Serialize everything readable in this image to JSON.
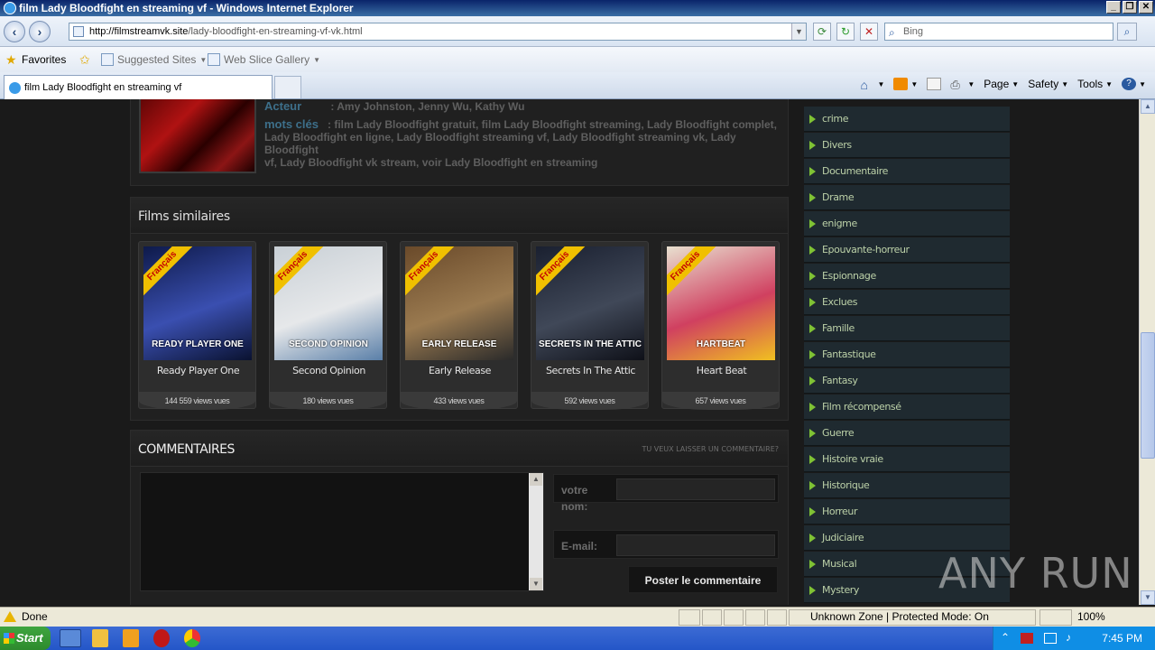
{
  "window": {
    "title": "film Lady Bloodfight en streaming vf - Windows Internet Explorer"
  },
  "address": {
    "url_host": "http://filmstreamvk.site",
    "url_path": "/lady-bloodfight-en-streaming-vf-vk.html",
    "search_placeholder": "Bing"
  },
  "favorites": {
    "favorites_label": "Favorites",
    "suggested_label": "Suggested Sites",
    "webslice_label": "Web Slice Gallery"
  },
  "tab": {
    "title": "film Lady Bloodfight en streaming vf"
  },
  "commands": {
    "page": "Page",
    "safety": "Safety",
    "tools": "Tools"
  },
  "info": {
    "actor_label": "Acteur",
    "actor_value": ": Amy Johnston, Jenny Wu, Kathy Wu",
    "keywords_label": "mots clés",
    "keywords_line1": ": film Lady Bloodfight gratuit, film Lady Bloodfight streaming, Lady Bloodfight complet,",
    "keywords_line2": "Lady Bloodfight en ligne, Lady Bloodfight streaming vf, Lady Bloodfight streaming vk, Lady Bloodfight",
    "keywords_line3": "vf, Lady Bloodfight vk stream, voir Lady Bloodfight en streaming"
  },
  "similar": {
    "heading": "Films similaires",
    "ribbon": "Français",
    "films": [
      {
        "title": "Ready Player One",
        "views": "144 559 views vues",
        "poster_text": "READY PLAYER ONE",
        "colors": [
          "#0e1a4a",
          "#3a4fb0",
          "#0a1230"
        ]
      },
      {
        "title": "Second Opinion",
        "views": "180 views vues",
        "poster_text": "SECOND OPINION",
        "colors": [
          "#c9d0d6",
          "#e6e8ea",
          "#5a7fa8"
        ]
      },
      {
        "title": "Early Release",
        "views": "433 views vues",
        "poster_text": "EARLY RELEASE",
        "colors": [
          "#6a4a2a",
          "#9a7a50",
          "#2a2a2a"
        ]
      },
      {
        "title": "Secrets In The Attic",
        "views": "592 views vues",
        "poster_text": "SECRETS IN THE ATTIC",
        "colors": [
          "#1a2030",
          "#404858",
          "#0e1018"
        ]
      },
      {
        "title": "Heart Beat",
        "views": "657 views vues",
        "poster_text": "HARTBEAT",
        "colors": [
          "#e8e0d0",
          "#d04060",
          "#f0c020"
        ]
      }
    ]
  },
  "comments": {
    "heading": "COMMENTAIRES",
    "leave_link": "TU VEUX LAISSER UN COMMENTAIRE?",
    "name_label": "votre nom:",
    "email_label": "E-mail:",
    "submit": "Poster le commentaire"
  },
  "categories": [
    "crime",
    "Divers",
    "Documentaire",
    "Drame",
    "enigme",
    "Epouvante-horreur",
    "Espionnage",
    "Exclues",
    "Famille",
    "Fantastique",
    "Fantasy",
    "Film récompensé",
    "Guerre",
    "Histoire vraie",
    "Historique",
    "Horreur",
    "Judiciaire",
    "Musical",
    "Mystery"
  ],
  "status": {
    "text": "Done",
    "zone": "Unknown Zone | Protected Mode: On",
    "zoom": "100%"
  },
  "taskbar": {
    "start": "Start",
    "clock": "7:45 PM"
  },
  "watermark": "ANY RUN"
}
